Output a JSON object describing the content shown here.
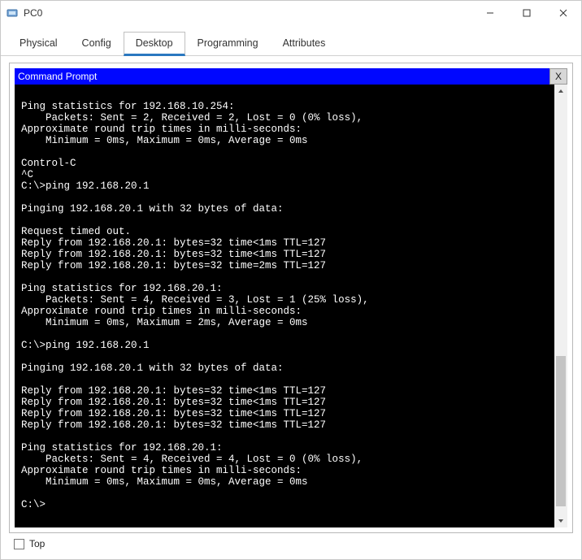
{
  "window": {
    "title": "PC0"
  },
  "tabs": {
    "items": [
      {
        "label": "Physical"
      },
      {
        "label": "Config"
      },
      {
        "label": "Desktop"
      },
      {
        "label": "Programming"
      },
      {
        "label": "Attributes"
      }
    ],
    "active_index": 2
  },
  "panel": {
    "title": "Command Prompt",
    "close_label": "X"
  },
  "terminal_lines": [
    "",
    "Ping statistics for 192.168.10.254:",
    "    Packets: Sent = 2, Received = 2, Lost = 0 (0% loss),",
    "Approximate round trip times in milli-seconds:",
    "    Minimum = 0ms, Maximum = 0ms, Average = 0ms",
    "",
    "Control-C",
    "^C",
    "C:\\>ping 192.168.20.1",
    "",
    "Pinging 192.168.20.1 with 32 bytes of data:",
    "",
    "Request timed out.",
    "Reply from 192.168.20.1: bytes=32 time<1ms TTL=127",
    "Reply from 192.168.20.1: bytes=32 time<1ms TTL=127",
    "Reply from 192.168.20.1: bytes=32 time=2ms TTL=127",
    "",
    "Ping statistics for 192.168.20.1:",
    "    Packets: Sent = 4, Received = 3, Lost = 1 (25% loss),",
    "Approximate round trip times in milli-seconds:",
    "    Minimum = 0ms, Maximum = 2ms, Average = 0ms",
    "",
    "C:\\>ping 192.168.20.1",
    "",
    "Pinging 192.168.20.1 with 32 bytes of data:",
    "",
    "Reply from 192.168.20.1: bytes=32 time<1ms TTL=127",
    "Reply from 192.168.20.1: bytes=32 time<1ms TTL=127",
    "Reply from 192.168.20.1: bytes=32 time<1ms TTL=127",
    "Reply from 192.168.20.1: bytes=32 time<1ms TTL=127",
    "",
    "Ping statistics for 192.168.20.1:",
    "    Packets: Sent = 4, Received = 4, Lost = 0 (0% loss),",
    "Approximate round trip times in milli-seconds:",
    "    Minimum = 0ms, Maximum = 0ms, Average = 0ms",
    "",
    "C:\\>"
  ],
  "bottom": {
    "checkbox_label": "Top",
    "checked": false
  }
}
